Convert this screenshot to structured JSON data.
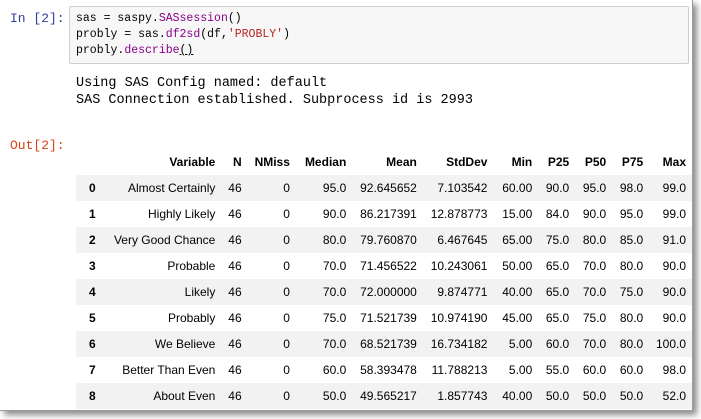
{
  "input_cell": {
    "prompt": "In [2]:",
    "line1": {
      "a": "sas = saspy.",
      "fn": "SASsession",
      "b": "()"
    },
    "line2": {
      "a": "probly = sas.",
      "fn": "df2sd",
      "b": "(df,",
      "str": "'PROBLY'",
      "c": ")"
    },
    "line3": {
      "a": "probly.",
      "fn": "describe",
      "u": "()"
    }
  },
  "stdout": [
    "Using SAS Config named: default",
    "SAS Connection established. Subprocess id is 2993"
  ],
  "output_cell": {
    "prompt": "Out[2]:"
  },
  "table": {
    "columns": [
      "",
      "Variable",
      "N",
      "NMiss",
      "Median",
      "Mean",
      "StdDev",
      "Min",
      "P25",
      "P50",
      "P75",
      "Max"
    ],
    "rows": [
      [
        "0",
        "Almost Certainly",
        "46",
        "0",
        "95.0",
        "92.645652",
        "7.103542",
        "60.00",
        "90.0",
        "95.0",
        "98.0",
        "99.0"
      ],
      [
        "1",
        "Highly Likely",
        "46",
        "0",
        "90.0",
        "86.217391",
        "12.878773",
        "15.00",
        "84.0",
        "90.0",
        "95.0",
        "99.0"
      ],
      [
        "2",
        "Very Good Chance",
        "46",
        "0",
        "80.0",
        "79.760870",
        "6.467645",
        "65.00",
        "75.0",
        "80.0",
        "85.0",
        "91.0"
      ],
      [
        "3",
        "Probable",
        "46",
        "0",
        "70.0",
        "71.456522",
        "10.243061",
        "50.00",
        "65.0",
        "70.0",
        "80.0",
        "90.0"
      ],
      [
        "4",
        "Likely",
        "46",
        "0",
        "70.0",
        "72.000000",
        "9.874771",
        "40.00",
        "65.0",
        "70.0",
        "75.0",
        "90.0"
      ],
      [
        "5",
        "Probably",
        "46",
        "0",
        "75.0",
        "71.521739",
        "10.974190",
        "45.00",
        "65.0",
        "75.0",
        "80.0",
        "90.0"
      ],
      [
        "6",
        "We Believe",
        "46",
        "0",
        "70.0",
        "68.521739",
        "16.734182",
        "5.00",
        "60.0",
        "70.0",
        "80.0",
        "100.0"
      ],
      [
        "7",
        "Better Than Even",
        "46",
        "0",
        "60.0",
        "58.393478",
        "11.788213",
        "5.00",
        "55.0",
        "60.0",
        "60.0",
        "98.0"
      ],
      [
        "8",
        "About Even",
        "46",
        "0",
        "50.0",
        "49.565217",
        "1.857743",
        "40.00",
        "50.0",
        "50.0",
        "50.0",
        "52.0"
      ]
    ]
  }
}
